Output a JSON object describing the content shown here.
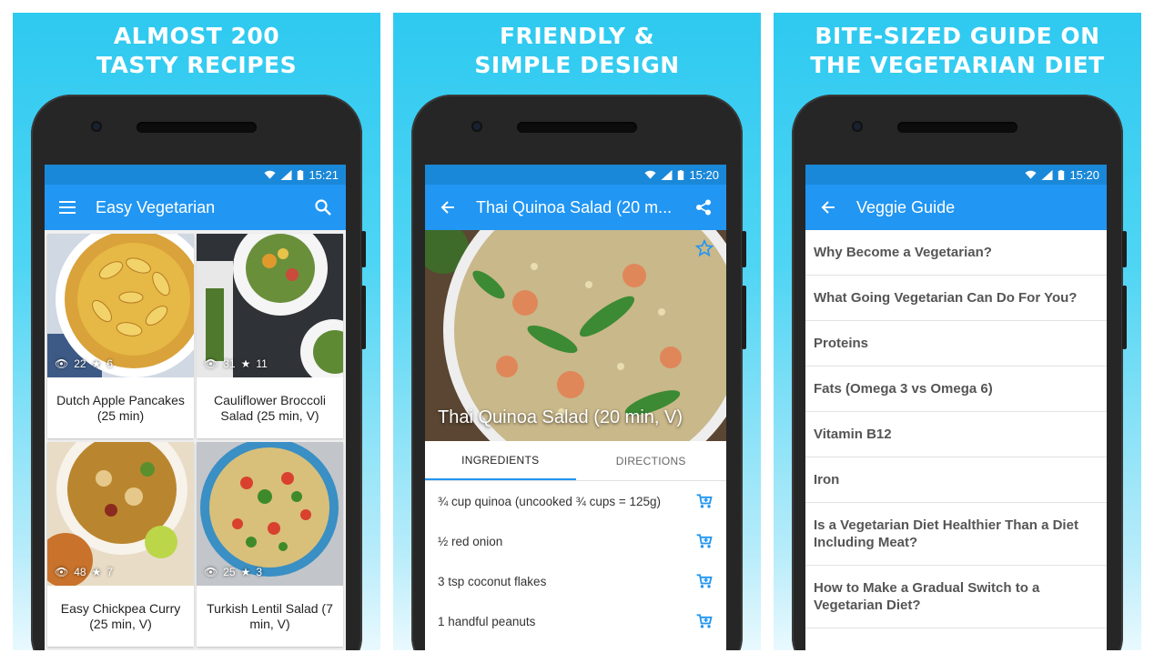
{
  "panels": [
    {
      "headline_1": "ALMOST 200",
      "headline_2": "TASTY RECIPES"
    },
    {
      "headline_1": "FRIENDLY &",
      "headline_2": "SIMPLE DESIGN"
    },
    {
      "headline_1": "BITE-SIZED GUIDE ON",
      "headline_2": "THE VEGETARIAN DIET"
    }
  ],
  "status": [
    {
      "time": "15:21"
    },
    {
      "time": "15:20"
    },
    {
      "time": "15:20"
    }
  ],
  "list_screen": {
    "title": "Easy Vegetarian",
    "menu_icon": "menu-icon",
    "search_icon": "search-icon",
    "recipes": [
      {
        "name": "Dutch Apple Pancakes (25 min)",
        "views": "22",
        "stars": "6"
      },
      {
        "name": "Cauliflower Broccoli Salad (25 min, V)",
        "views": "31",
        "stars": "11"
      },
      {
        "name": "Easy Chickpea Curry (25 min, V)",
        "views": "48",
        "stars": "7"
      },
      {
        "name": "Turkish Lentil Salad (7 min, V)",
        "views": "25",
        "stars": "3"
      }
    ]
  },
  "detail_screen": {
    "title": "Thai Quinoa Salad (20 m...",
    "hero_caption": "Thai Quinoa Salad (20 min, V)",
    "tabs": [
      "INGREDIENTS",
      "DIRECTIONS"
    ],
    "ingredients": [
      "¾ cup quinoa (uncooked ¾ cups = 125g)",
      "½ red onion",
      "3 tsp coconut flakes",
      "1 handful peanuts"
    ]
  },
  "guide_screen": {
    "title": "Veggie Guide",
    "items": [
      "Why Become a Vegetarian?",
      "What Going Vegetarian Can Do For You?",
      "Proteins",
      "Fats (Omega 3 vs Omega 6)",
      "Vitamin B12",
      "Iron",
      "Is a Vegetarian Diet Healthier Than a Diet Including Meat?",
      "How to Make a Gradual Switch to a Vegetarian Diet?"
    ]
  },
  "colors": {
    "appbar": "#2196f3",
    "statusbar": "#1a88d8",
    "banner": "#2ec9f0"
  }
}
